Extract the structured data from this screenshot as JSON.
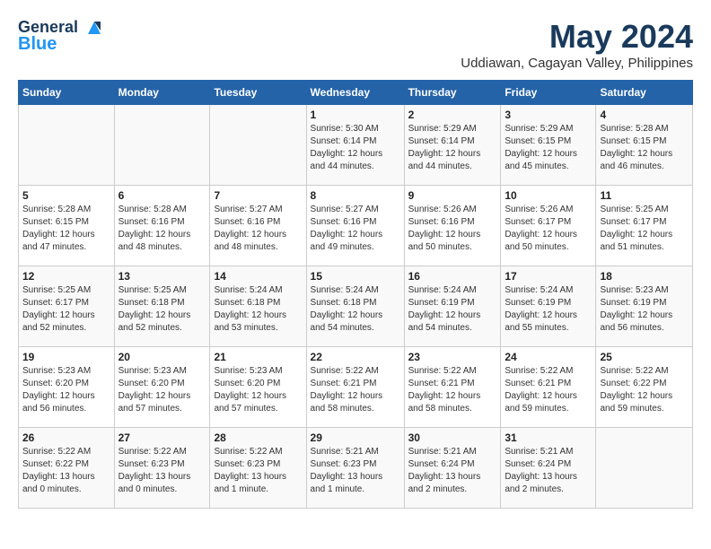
{
  "header": {
    "logo_line1": "General",
    "logo_line2": "Blue",
    "month_title": "May 2024",
    "subtitle": "Uddiawan, Cagayan Valley, Philippines"
  },
  "days_of_week": [
    "Sunday",
    "Monday",
    "Tuesday",
    "Wednesday",
    "Thursday",
    "Friday",
    "Saturday"
  ],
  "weeks": [
    [
      {
        "day": "",
        "info": ""
      },
      {
        "day": "",
        "info": ""
      },
      {
        "day": "",
        "info": ""
      },
      {
        "day": "1",
        "info": "Sunrise: 5:30 AM\nSunset: 6:14 PM\nDaylight: 12 hours and 44 minutes."
      },
      {
        "day": "2",
        "info": "Sunrise: 5:29 AM\nSunset: 6:14 PM\nDaylight: 12 hours and 44 minutes."
      },
      {
        "day": "3",
        "info": "Sunrise: 5:29 AM\nSunset: 6:15 PM\nDaylight: 12 hours and 45 minutes."
      },
      {
        "day": "4",
        "info": "Sunrise: 5:28 AM\nSunset: 6:15 PM\nDaylight: 12 hours and 46 minutes."
      }
    ],
    [
      {
        "day": "5",
        "info": "Sunrise: 5:28 AM\nSunset: 6:15 PM\nDaylight: 12 hours and 47 minutes."
      },
      {
        "day": "6",
        "info": "Sunrise: 5:28 AM\nSunset: 6:16 PM\nDaylight: 12 hours and 48 minutes."
      },
      {
        "day": "7",
        "info": "Sunrise: 5:27 AM\nSunset: 6:16 PM\nDaylight: 12 hours and 48 minutes."
      },
      {
        "day": "8",
        "info": "Sunrise: 5:27 AM\nSunset: 6:16 PM\nDaylight: 12 hours and 49 minutes."
      },
      {
        "day": "9",
        "info": "Sunrise: 5:26 AM\nSunset: 6:16 PM\nDaylight: 12 hours and 50 minutes."
      },
      {
        "day": "10",
        "info": "Sunrise: 5:26 AM\nSunset: 6:17 PM\nDaylight: 12 hours and 50 minutes."
      },
      {
        "day": "11",
        "info": "Sunrise: 5:25 AM\nSunset: 6:17 PM\nDaylight: 12 hours and 51 minutes."
      }
    ],
    [
      {
        "day": "12",
        "info": "Sunrise: 5:25 AM\nSunset: 6:17 PM\nDaylight: 12 hours and 52 minutes."
      },
      {
        "day": "13",
        "info": "Sunrise: 5:25 AM\nSunset: 6:18 PM\nDaylight: 12 hours and 52 minutes."
      },
      {
        "day": "14",
        "info": "Sunrise: 5:24 AM\nSunset: 6:18 PM\nDaylight: 12 hours and 53 minutes."
      },
      {
        "day": "15",
        "info": "Sunrise: 5:24 AM\nSunset: 6:18 PM\nDaylight: 12 hours and 54 minutes."
      },
      {
        "day": "16",
        "info": "Sunrise: 5:24 AM\nSunset: 6:19 PM\nDaylight: 12 hours and 54 minutes."
      },
      {
        "day": "17",
        "info": "Sunrise: 5:24 AM\nSunset: 6:19 PM\nDaylight: 12 hours and 55 minutes."
      },
      {
        "day": "18",
        "info": "Sunrise: 5:23 AM\nSunset: 6:19 PM\nDaylight: 12 hours and 56 minutes."
      }
    ],
    [
      {
        "day": "19",
        "info": "Sunrise: 5:23 AM\nSunset: 6:20 PM\nDaylight: 12 hours and 56 minutes."
      },
      {
        "day": "20",
        "info": "Sunrise: 5:23 AM\nSunset: 6:20 PM\nDaylight: 12 hours and 57 minutes."
      },
      {
        "day": "21",
        "info": "Sunrise: 5:23 AM\nSunset: 6:20 PM\nDaylight: 12 hours and 57 minutes."
      },
      {
        "day": "22",
        "info": "Sunrise: 5:22 AM\nSunset: 6:21 PM\nDaylight: 12 hours and 58 minutes."
      },
      {
        "day": "23",
        "info": "Sunrise: 5:22 AM\nSunset: 6:21 PM\nDaylight: 12 hours and 58 minutes."
      },
      {
        "day": "24",
        "info": "Sunrise: 5:22 AM\nSunset: 6:21 PM\nDaylight: 12 hours and 59 minutes."
      },
      {
        "day": "25",
        "info": "Sunrise: 5:22 AM\nSunset: 6:22 PM\nDaylight: 12 hours and 59 minutes."
      }
    ],
    [
      {
        "day": "26",
        "info": "Sunrise: 5:22 AM\nSunset: 6:22 PM\nDaylight: 13 hours and 0 minutes."
      },
      {
        "day": "27",
        "info": "Sunrise: 5:22 AM\nSunset: 6:23 PM\nDaylight: 13 hours and 0 minutes."
      },
      {
        "day": "28",
        "info": "Sunrise: 5:22 AM\nSunset: 6:23 PM\nDaylight: 13 hours and 1 minute."
      },
      {
        "day": "29",
        "info": "Sunrise: 5:21 AM\nSunset: 6:23 PM\nDaylight: 13 hours and 1 minute."
      },
      {
        "day": "30",
        "info": "Sunrise: 5:21 AM\nSunset: 6:24 PM\nDaylight: 13 hours and 2 minutes."
      },
      {
        "day": "31",
        "info": "Sunrise: 5:21 AM\nSunset: 6:24 PM\nDaylight: 13 hours and 2 minutes."
      },
      {
        "day": "",
        "info": ""
      }
    ]
  ]
}
